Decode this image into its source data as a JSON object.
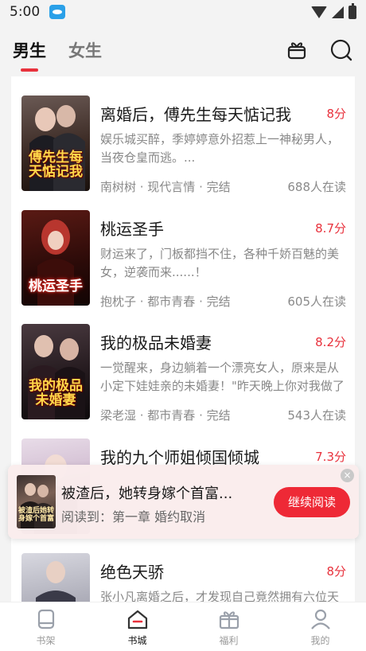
{
  "status_bar": {
    "time": "5:00"
  },
  "header": {
    "tabs": [
      {
        "label": "男生",
        "active": true
      },
      {
        "label": "女生",
        "active": false
      }
    ]
  },
  "books": [
    {
      "title": "离婚后，傅先生每天惦记我",
      "score": "8分",
      "desc": "娱乐城买醉，季婷婷意外招惹上一神秘男人，当夜仓皇而逃。...",
      "meta": "南树树 · 现代言情 · 完结",
      "readers": "688人在读",
      "cover_text": "傅先生每天惦记我",
      "cover_color": "#2b1a14"
    },
    {
      "title": "桃运圣手",
      "score": "8.7分",
      "desc": "财运来了，门板都挡不住，各种千娇百魅的美女，逆袭而来......！",
      "meta": "抱枕子 · 都市青春 · 完结",
      "readers": "605人在读",
      "cover_text": "桃运圣手",
      "cover_color": "#3a1010"
    },
    {
      "title": "我的极品未婚妻",
      "score": "8.2分",
      "desc": "一觉醒来，身边躺着一个漂亮女人，原来是从小定下娃娃亲的未婚妻！\"昨天晚上你对我做了什...",
      "meta": "梁老湿 · 都市青春 · 完结",
      "readers": "543人在读",
      "cover_text": "我的极品未婚妻",
      "cover_color": "#1e1418"
    },
    {
      "title": "我的九个师姐倾国倾城",
      "score": "7.3分",
      "desc": "",
      "meta": "",
      "readers": "",
      "cover_text": "",
      "cover_color": "#d8c8d8"
    },
    {
      "title": "绝色天骄",
      "score": "8分",
      "desc": "张小凡离婚之后，才发现自己竟然拥有六位天下",
      "meta": "",
      "readers": "",
      "cover_text": "",
      "cover_color": "#c8c8d0"
    }
  ],
  "continue_popup": {
    "title": "被渣后，她转身嫁个首富...",
    "progress": "阅读到：第一章 婚约取消",
    "button": "继续阅读",
    "cover_text": "被渣后她转身嫁个首富",
    "close": "×"
  },
  "bottom_nav": [
    {
      "label": "书架",
      "icon": "bookshelf-icon",
      "active": false
    },
    {
      "label": "书城",
      "icon": "bookstore-icon",
      "active": true
    },
    {
      "label": "福利",
      "icon": "gift-icon",
      "active": false
    },
    {
      "label": "我的",
      "icon": "profile-icon",
      "active": false
    }
  ],
  "colors": {
    "accent": "#e8313c",
    "button": "#ee2936"
  }
}
